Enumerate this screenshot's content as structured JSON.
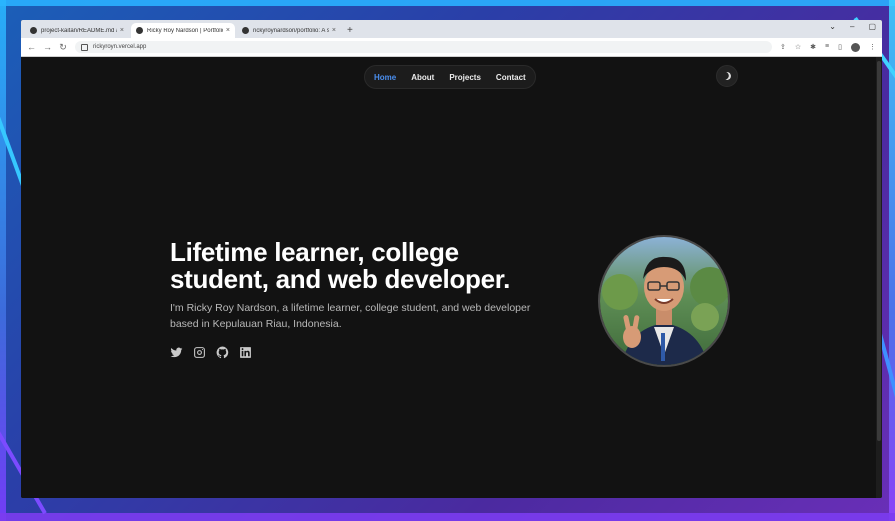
{
  "browser": {
    "tabs": [
      {
        "title": "project-kaitan/README.md at ...",
        "active": false
      },
      {
        "title": "Ricky Roy Nardson | Portfolio",
        "active": true
      },
      {
        "title": "rickyroynardson/portfolio: A sim...",
        "active": false
      }
    ],
    "new_tab_label": "+",
    "url": "rickyroyn.vercel.app"
  },
  "nav": {
    "items": [
      {
        "label": "Home",
        "active": true
      },
      {
        "label": "About",
        "active": false
      },
      {
        "label": "Projects",
        "active": false
      },
      {
        "label": "Contact",
        "active": false
      }
    ]
  },
  "hero": {
    "title_line1": "Lifetime learner, college",
    "title_line2": "student, and web developer.",
    "subtitle_line1": "I'm Ricky Roy Nardson, a lifetime learner, college student, and web developer",
    "subtitle_line2": "based in Kepulauan Riau, Indonesia."
  },
  "socials": [
    "twitter-icon",
    "instagram-icon",
    "github-icon",
    "linkedin-icon"
  ],
  "colors": {
    "background": "#121212",
    "accent": "#4a8ff0",
    "text": "#ffffff",
    "muted": "#b8b8b8"
  }
}
